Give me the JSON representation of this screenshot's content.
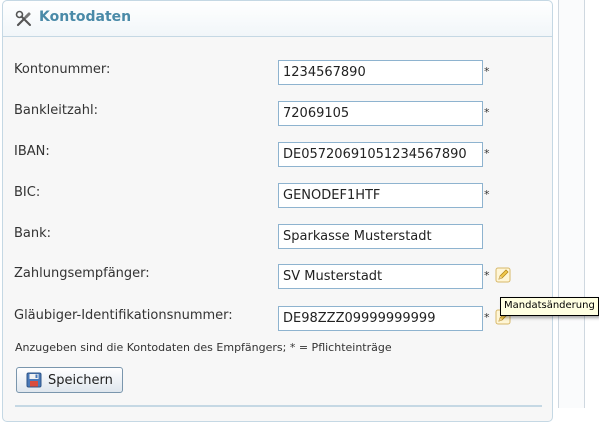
{
  "panel": {
    "title": "Kontodaten",
    "header_icon": "tools-icon"
  },
  "fields": [
    {
      "label": "Kontonummer:",
      "value": "1234567890",
      "required": "*"
    },
    {
      "label": "Bankleitzahl:",
      "value": "72069105",
      "required": "*"
    },
    {
      "label": "IBAN:",
      "value": "DE05720691051234567890",
      "required": "*"
    },
    {
      "label": "BIC:",
      "value": "GENODEF1HTF",
      "required": "*"
    },
    {
      "label": "Bank:",
      "value": "Sparkasse Musterstadt",
      "required": ""
    },
    {
      "label": "Zahlungsempfänger:",
      "value": "SV Musterstadt",
      "required": "*",
      "action_icon": "pencil-icon"
    },
    {
      "label": "Gläubiger-Identifikationsnummer:",
      "value": "DE98ZZZ09999999999",
      "required": "*",
      "action_icon": "pencil-icon"
    }
  ],
  "hint": "Anzugeben sind die Kontodaten des Empfängers; * = Pflichteinträge",
  "save_button": {
    "label": "Speichern",
    "icon": "floppy-disk-icon"
  },
  "tooltip": "Mandatsänderung",
  "colors": {
    "accent": "#4a8aa8",
    "border": "#c5d8e4",
    "input_border": "#8eb3cf",
    "tooltip_bg": "#ffffe1"
  }
}
